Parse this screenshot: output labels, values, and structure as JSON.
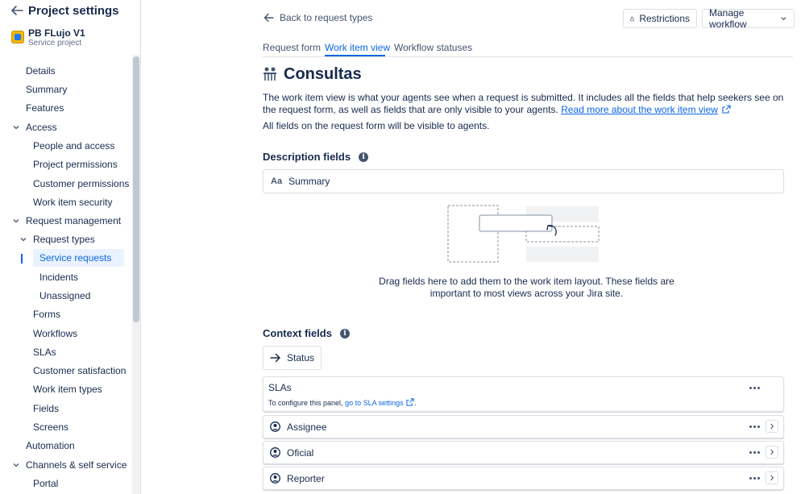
{
  "sidebar": {
    "title": "Project settings",
    "project_name": "PB FLujo V1",
    "project_type": "Service project",
    "items": [
      {
        "label": "Details"
      },
      {
        "label": "Summary"
      },
      {
        "label": "Features"
      },
      {
        "label": "Access"
      },
      {
        "label": "People and access"
      },
      {
        "label": "Project permissions"
      },
      {
        "label": "Customer permissions"
      },
      {
        "label": "Work item security"
      },
      {
        "label": "Request management"
      },
      {
        "label": "Request types"
      },
      {
        "label": "Service requests"
      },
      {
        "label": "Incidents"
      },
      {
        "label": "Unassigned"
      },
      {
        "label": "Forms"
      },
      {
        "label": "Workflows"
      },
      {
        "label": "SLAs"
      },
      {
        "label": "Customer satisfaction"
      },
      {
        "label": "Work item types"
      },
      {
        "label": "Fields"
      },
      {
        "label": "Screens"
      },
      {
        "label": "Automation"
      },
      {
        "label": "Channels & self service"
      },
      {
        "label": "Portal"
      }
    ]
  },
  "header": {
    "back_label": "Back to request types",
    "restrictions_label": "Restrictions",
    "manage_workflow_label": "Manage workflow"
  },
  "tabs": [
    {
      "label": "Request form"
    },
    {
      "label": "Work item view"
    },
    {
      "label": "Workflow statuses"
    }
  ],
  "page": {
    "title": "Consultas",
    "description_start": "The work item view is what your agents see when a request is submitted. It includes all the fields that help seekers see on the request form, as well as fields that are only visible to your agents. ",
    "description_link": "Read more about the work item view",
    "description_line2": "All fields on the request form will be visible to agents."
  },
  "description_fields": {
    "heading": "Description fields",
    "fields": [
      {
        "icon": "Aa",
        "label": "Summary"
      }
    ],
    "drop_hint": "Drag fields here to add them to the work item layout. These fields are important to most views across your Jira site."
  },
  "context_fields": {
    "heading": "Context fields",
    "status_label": "Status",
    "slas_panel": {
      "title": "SLAs",
      "sub_prefix": "To configure this panel, ",
      "sub_link": "go to SLA settings",
      "sub_suffix": "."
    },
    "rows": [
      {
        "label": "Assignee"
      },
      {
        "label": "Oficial"
      },
      {
        "label": "Reporter"
      }
    ]
  },
  "colors": {
    "accent": "#0c66e4",
    "text": "#172b4d",
    "border": "#dcdfe4"
  }
}
